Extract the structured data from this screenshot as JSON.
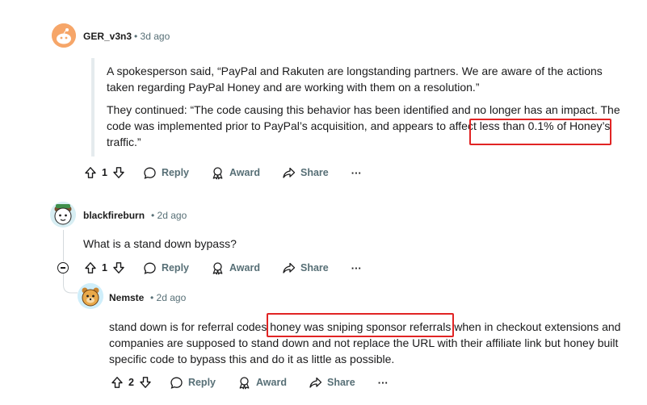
{
  "comments": [
    {
      "username": "GER_v3n3",
      "time": "3d ago",
      "quote": [
        "A spokesperson said, “PayPal and Rakuten are longstanding partners. We are aware of the actions taken regarding PayPal Honey and are working with them on a resolution.”",
        "They continued: “The code causing this behavior has been identified and no longer has an impact. The code was implemented prior to PayPal’s acquisition, and appears to affect less than 0.1% of Honey’s traffic.”"
      ],
      "votes": "1",
      "reply": "Reply",
      "award": "Award",
      "share": "Share",
      "more": "···"
    },
    {
      "username": "blackfireburn",
      "time": "2d ago",
      "text": "What is a stand down bypass?",
      "votes": "1",
      "reply": "Reply",
      "award": "Award",
      "share": "Share",
      "more": "···"
    },
    {
      "username": "Nemste",
      "time": "2d ago",
      "text": "stand down is for referral codes honey was sniping sponsor referrals when in checkout extensions and companies are supposed to stand down and not replace the URL with their affiliate link but honey built specific code to bypass this and do it as little as possible.",
      "votes": "2",
      "reply": "Reply",
      "award": "Award",
      "share": "Share",
      "more": "···"
    }
  ],
  "colors": {
    "highlight": "#e12424",
    "meta": "#576f76"
  }
}
